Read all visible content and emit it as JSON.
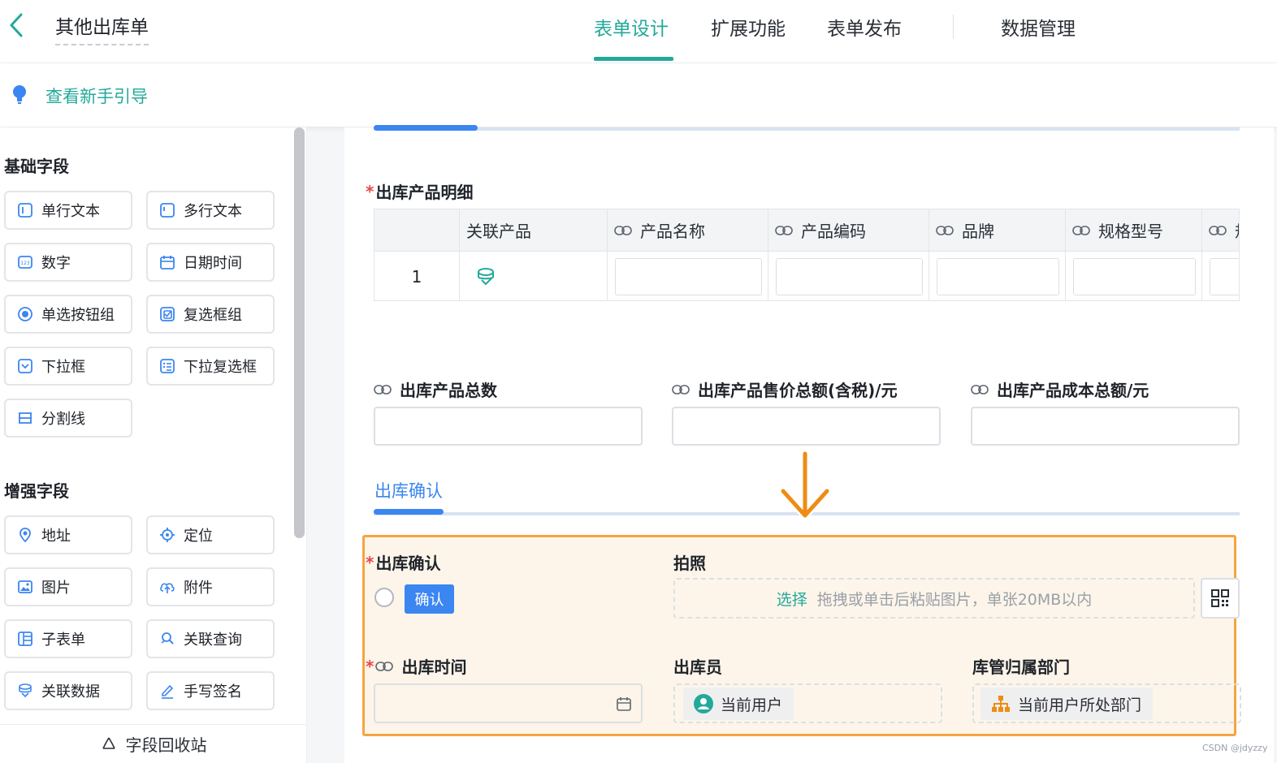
{
  "header": {
    "title": "其他出库单",
    "tabs": [
      {
        "label": "表单设计",
        "active": true
      },
      {
        "label": "扩展功能"
      },
      {
        "label": "表单发布"
      },
      {
        "label": "数据管理"
      }
    ]
  },
  "guide": {
    "label": "查看新手引导"
  },
  "sidebar": {
    "basic_title": "基础字段",
    "basic_fields": [
      {
        "label": "单行文本",
        "icon": "single-line-text-icon"
      },
      {
        "label": "多行文本",
        "icon": "multi-line-text-icon"
      },
      {
        "label": "数字",
        "icon": "number-icon"
      },
      {
        "label": "日期时间",
        "icon": "calendar-icon"
      },
      {
        "label": "单选按钮组",
        "icon": "radio-icon"
      },
      {
        "label": "复选框组",
        "icon": "checkbox-icon"
      },
      {
        "label": "下拉框",
        "icon": "dropdown-icon"
      },
      {
        "label": "下拉复选框",
        "icon": "dropdown-checkbox-icon"
      },
      {
        "label": "分割线",
        "icon": "divider-icon"
      }
    ],
    "enhanced_title": "增强字段",
    "enhanced_fields": [
      {
        "label": "地址",
        "icon": "location-pin-icon"
      },
      {
        "label": "定位",
        "icon": "crosshair-icon"
      },
      {
        "label": "图片",
        "icon": "image-icon"
      },
      {
        "label": "附件",
        "icon": "upload-cloud-icon"
      },
      {
        "label": "子表单",
        "icon": "subform-icon"
      },
      {
        "label": "关联查询",
        "icon": "linked-query-icon"
      },
      {
        "label": "关联数据",
        "icon": "linked-data-icon"
      },
      {
        "label": "手写签名",
        "icon": "pen-icon"
      }
    ],
    "recycle_label": "字段回收站"
  },
  "form": {
    "detail_label": "出库产品明细",
    "table": {
      "columns": [
        "",
        "关联产品",
        "产品名称",
        "产品编码",
        "品牌",
        "规格型号",
        "规"
      ],
      "row_index": "1"
    },
    "totals": [
      {
        "label": "出库产品总数"
      },
      {
        "label": "出库产品售价总额(含税)/元"
      },
      {
        "label": "出库产品成本总额/元"
      }
    ],
    "confirm_section_title": "出库确认",
    "confirm": {
      "confirm_label": "出库确认",
      "confirm_button": "确认",
      "photo_label": "拍照",
      "photo_select": "选择",
      "photo_hint": "拖拽或单击后粘贴图片，单张20MB以内",
      "out_time_label": "出库时间",
      "operator_label": "出库员",
      "operator_value": "当前用户",
      "dept_label": "库管归属部门",
      "dept_value": "当前用户所处部门"
    }
  },
  "watermark": "CSDN @jdyzzy",
  "colors": {
    "accent": "#23a99a",
    "blue": "#3b86f0",
    "highlight": "#f5a442",
    "arrow": "#ee8c14"
  }
}
